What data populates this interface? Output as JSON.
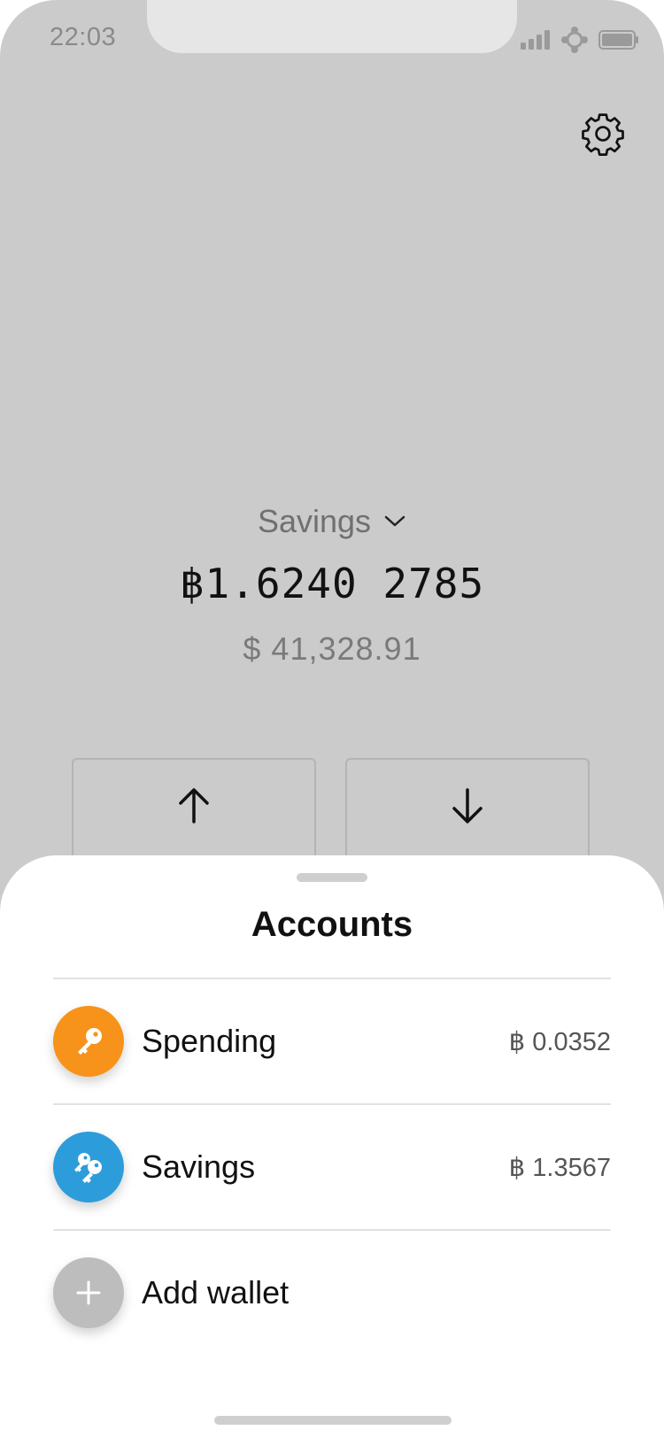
{
  "status_bar": {
    "time": "22:03"
  },
  "colors": {
    "spending_accent": "#f7931a",
    "savings_accent": "#2d9cdb",
    "add_wallet_accent": "#bdbdbd",
    "backdrop": "#cbcbcb"
  },
  "header": {
    "settings_icon": "gear-icon"
  },
  "wallet": {
    "selected_account": "Savings",
    "balance_btc": "฿1.6240 2785",
    "balance_usd": "$ 41,328.91"
  },
  "actions": [
    {
      "name": "send",
      "icon": "arrow-up-icon"
    },
    {
      "name": "receive",
      "icon": "arrow-down-icon"
    }
  ],
  "sheet": {
    "title": "Accounts",
    "accounts": [
      {
        "label": "Spending",
        "amount": "฿ 0.0352",
        "icon": "key-icon"
      },
      {
        "label": "Savings",
        "amount": "฿ 1.3567",
        "icon": "multi-key-icon"
      }
    ],
    "add_wallet": {
      "label": "Add wallet",
      "icon": "plus-icon"
    }
  }
}
